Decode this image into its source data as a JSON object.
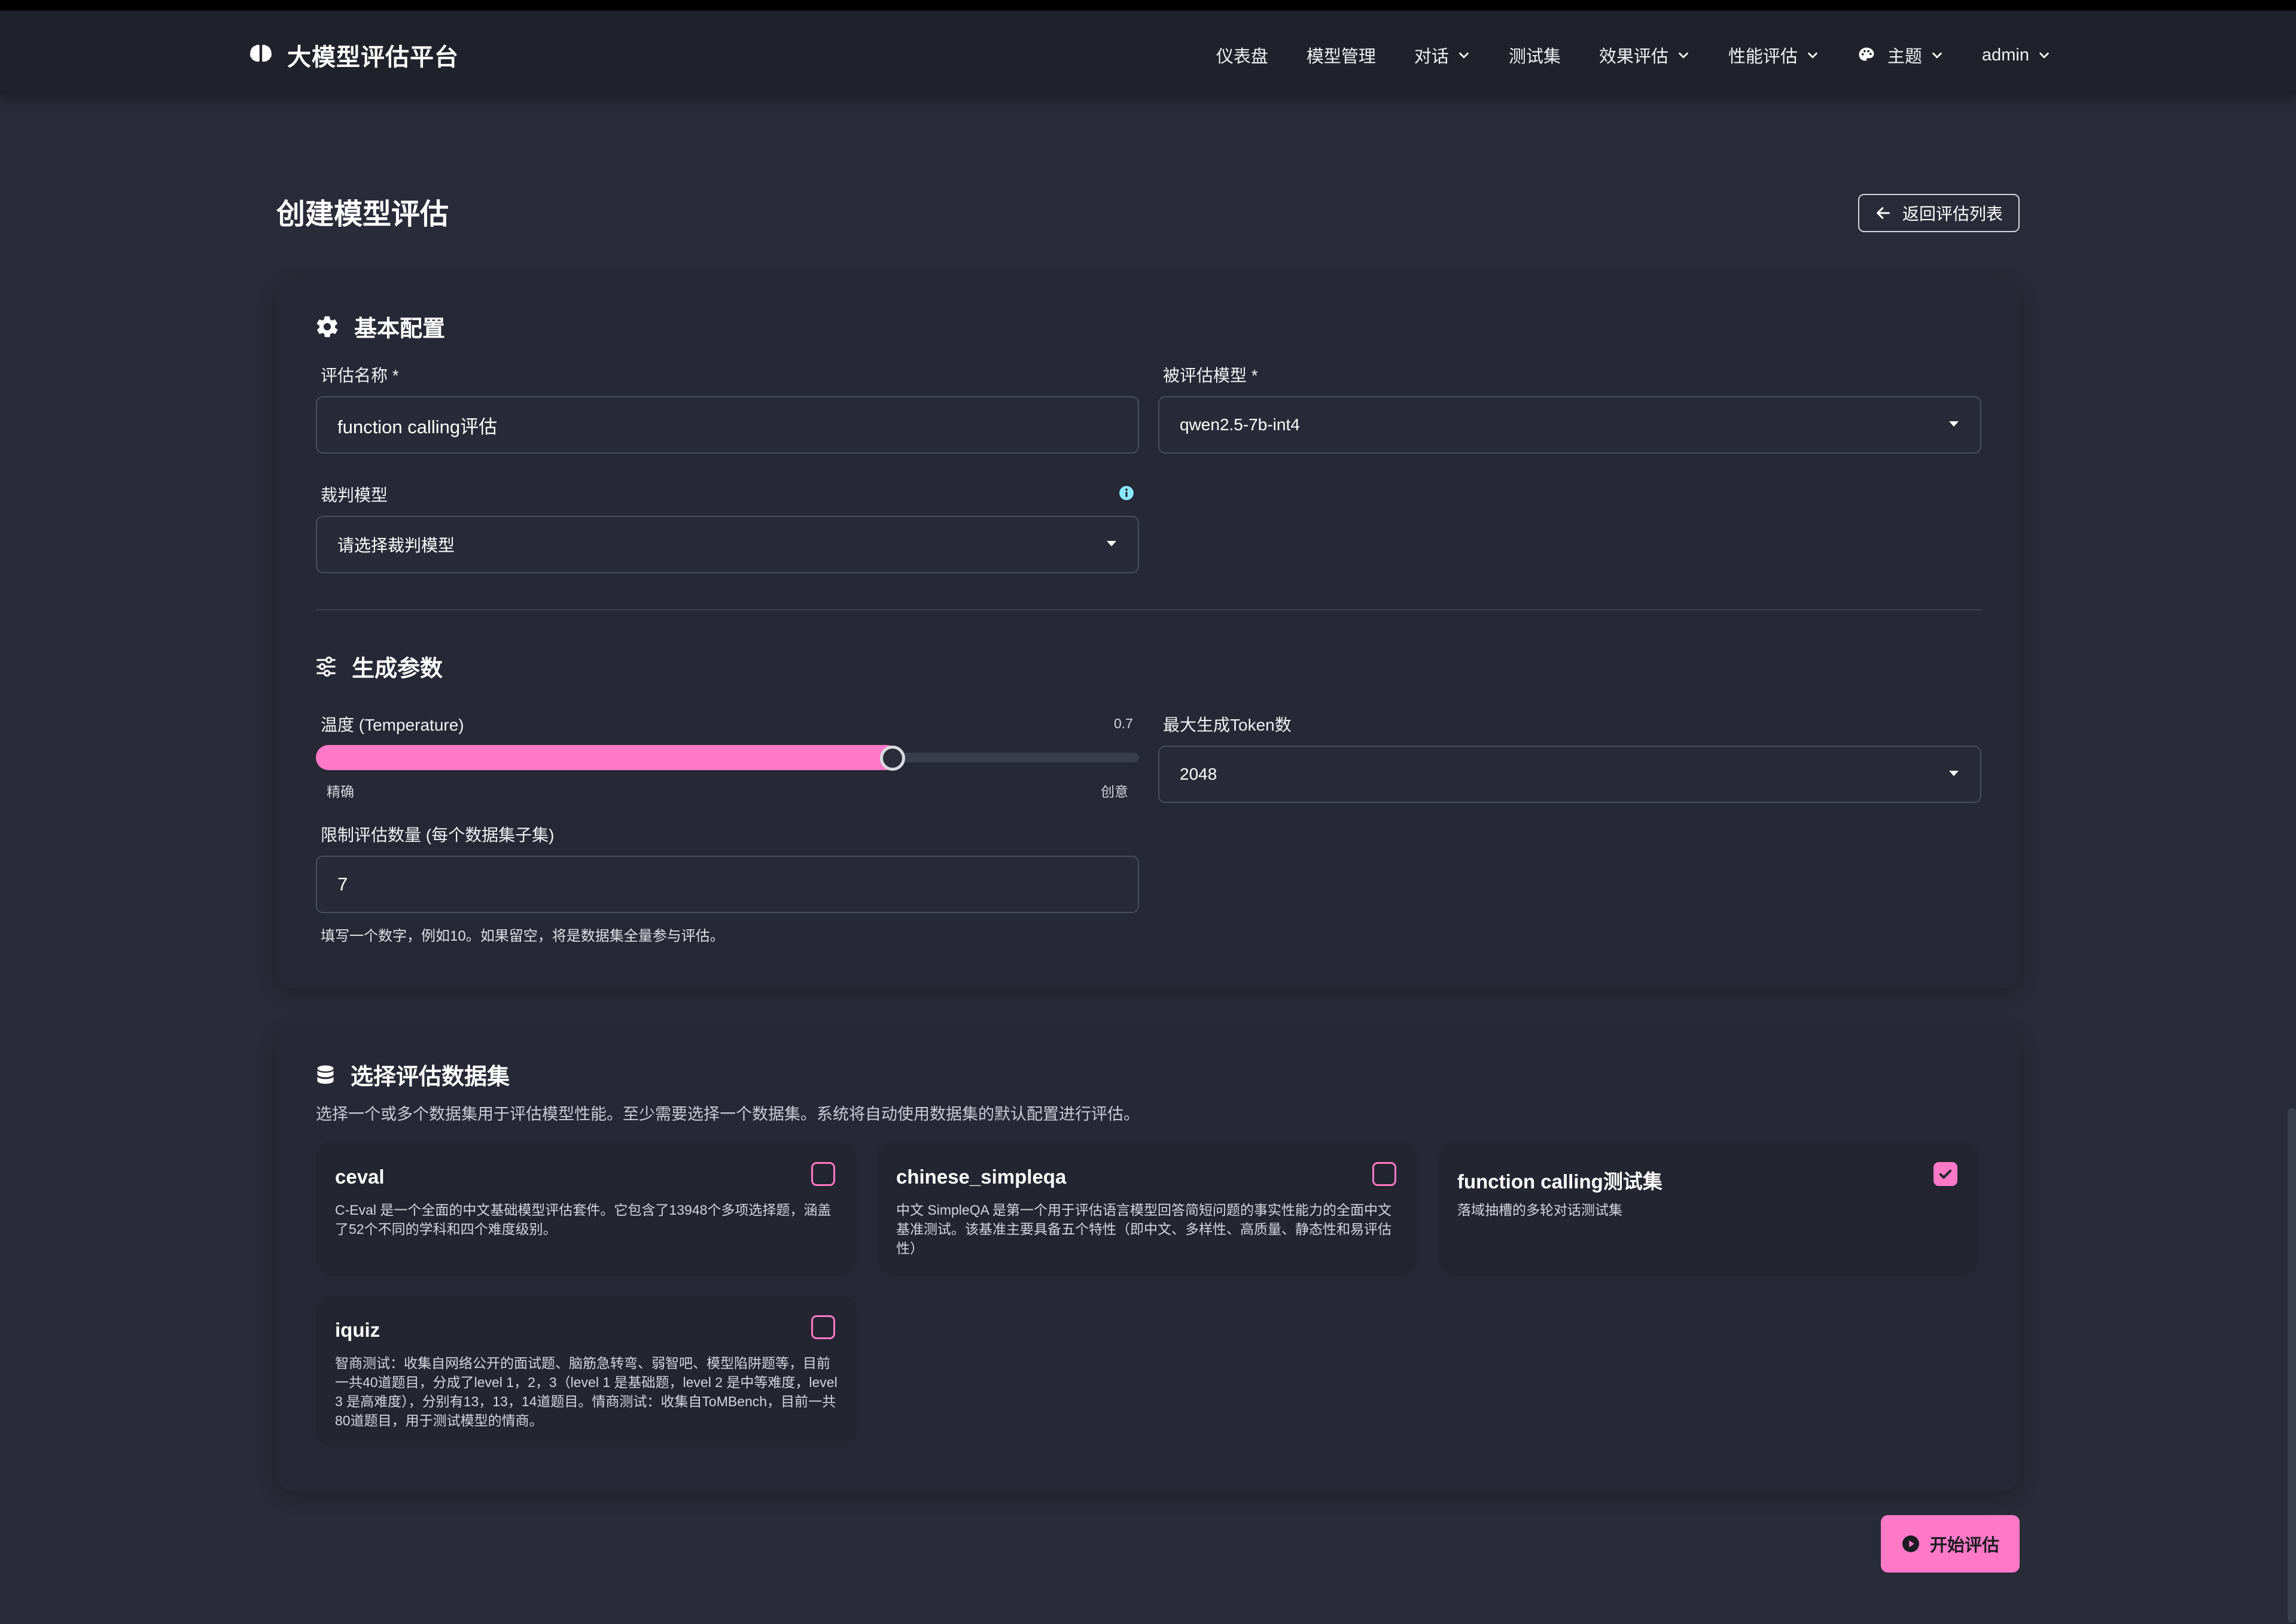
{
  "app": {
    "brand": "大模型评估平台",
    "brand_icon": "brain-icon"
  },
  "nav": {
    "dashboard": "仪表盘",
    "models": "模型管理",
    "chat": "对话",
    "testsets": "测试集",
    "effect_eval": "效果评估",
    "perf_eval": "性能评估",
    "theme": "主题",
    "user": "admin"
  },
  "page": {
    "title": "创建模型评估",
    "back_label": "返回评估列表"
  },
  "basic": {
    "heading": "基本配置",
    "name_label": "评估名称 *",
    "name_value": "function calling评估",
    "model_label": "被评估模型 *",
    "model_value": "qwen2.5-7b-int4",
    "judge_label": "裁判模型",
    "judge_placeholder": "请选择裁判模型"
  },
  "gen": {
    "heading": "生成参数",
    "temp_label": "温度 (Temperature)",
    "temp_value_text": "0.7",
    "temp_value": 0.7,
    "temp_min_label": "精确",
    "temp_max_label": "创意",
    "max_tokens_label": "最大生成Token数",
    "max_tokens_value": "2048",
    "limit_label": "限制评估数量 (每个数据集子集)",
    "limit_value": "7",
    "limit_hint": "填写一个数字，例如10。如果留空，将是数据集全量参与评估。"
  },
  "datasets": {
    "heading": "选择评估数据集",
    "subtitle": "选择一个或多个数据集用于评估模型性能。至少需要选择一个数据集。系统将自动使用数据集的默认配置进行评估。",
    "items": [
      {
        "name": "ceval",
        "desc": "C-Eval 是一个全面的中文基础模型评估套件。它包含了13948个多项选择题，涵盖了52个不同的学科和四个难度级别。",
        "checked": false
      },
      {
        "name": "chinese_simpleqa",
        "desc": "中文 SimpleQA 是第一个用于评估语言模型回答简短问题的事实性能力的全面中文基准测试。该基准主要具备五个特性（即中文、多样性、高质量、静态性和易评估性）",
        "checked": false
      },
      {
        "name": "function calling测试集",
        "desc": "落域抽槽的多轮对话测试集",
        "checked": true
      },
      {
        "name": "iquiz",
        "desc": "智商测试：收集自网络公开的面试题、脑筋急转弯、弱智吧、模型陷阱题等，目前一共40道题目，分成了level 1，2，3（level 1 是基础题，level 2 是中等难度，level 3 是高难度），分别有13，13，14道题目。情商测试：收集自ToMBench，目前一共80道题目，用于测试模型的情商。",
        "checked": false
      }
    ]
  },
  "actions": {
    "start_label": "开始评估"
  },
  "colors": {
    "accent": "#ff79c6",
    "background": "#292b38",
    "navbar": "#1f212b"
  }
}
